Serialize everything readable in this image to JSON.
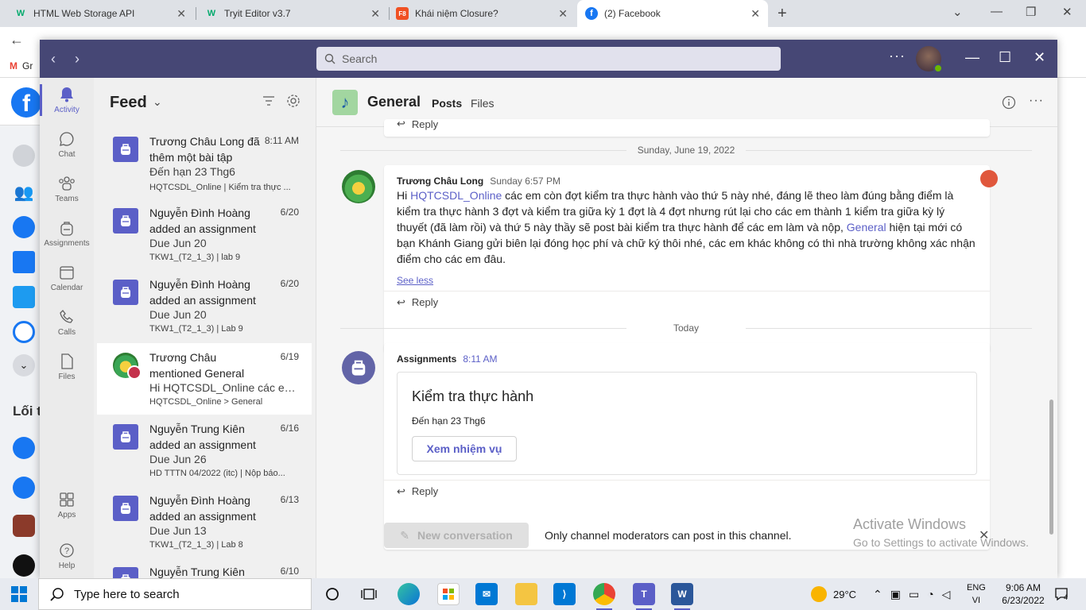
{
  "browser": {
    "tabs": [
      {
        "title": "HTML Web Storage API",
        "favicon": "W",
        "color": "#04aa6d"
      },
      {
        "title": "Tryit Editor v3.7",
        "favicon": "W",
        "color": "#04aa6d"
      },
      {
        "title": "Khái niệm Closure?",
        "favicon": "F8",
        "color": "#f05123"
      },
      {
        "title": "(2) Facebook",
        "favicon": "f",
        "color": "#1877f2"
      }
    ],
    "bookmark_label": "Gr",
    "fb_sidebar_text": "Lối t"
  },
  "teams": {
    "search_placeholder": "Search",
    "rail": [
      {
        "label": "Activity",
        "icon": "bell-icon"
      },
      {
        "label": "Chat",
        "icon": "chat-icon"
      },
      {
        "label": "Teams",
        "icon": "teams-icon"
      },
      {
        "label": "Assignments",
        "icon": "backpack-icon"
      },
      {
        "label": "Calendar",
        "icon": "calendar-icon"
      },
      {
        "label": "Calls",
        "icon": "phone-icon"
      },
      {
        "label": "Files",
        "icon": "file-icon"
      },
      {
        "label": "Apps",
        "icon": "apps-icon"
      },
      {
        "label": "Help",
        "icon": "help-icon"
      }
    ],
    "feed": {
      "title": "Feed",
      "items": [
        {
          "title": "Trương Châu Long đã thêm một bài tập",
          "date": "8:11 AM",
          "sub": "Đến hạn 23 Thg6",
          "meta": "HQTCSDL_Online | Kiểm tra thực ..."
        },
        {
          "title": "Nguyễn Đình Hoàng added an assignment",
          "date": "6/20",
          "sub": "Due Jun 20",
          "meta": "TKW1_(T2_1_3) | lab 9"
        },
        {
          "title": "Nguyễn Đình Hoàng added an assignment",
          "date": "6/20",
          "sub": "Due Jun 20",
          "meta": "TKW1_(T2_1_3) | Lab 9"
        },
        {
          "title": "Trương Châu mentioned General",
          "date": "6/19",
          "sub": "Hi HQTCSDL_Online các em ...",
          "meta": "HQTCSDL_Online > General"
        },
        {
          "title": "Nguyễn Trung Kiên added an assignment",
          "date": "6/16",
          "sub": "Due Jun 26",
          "meta": "HD TTTN 04/2022 (itc) | Nộp báo..."
        },
        {
          "title": "Nguyễn Đình Hoàng added an assignment",
          "date": "6/13",
          "sub": "Due Jun 13",
          "meta": "TKW1_(T2_1_3) | Lab 8"
        },
        {
          "title": "Nguyễn Trung Kiên",
          "date": "6/10",
          "sub": "",
          "meta": ""
        }
      ]
    },
    "channel": {
      "name": "General",
      "tabs": [
        "Posts",
        "Files"
      ],
      "reply_label": "Reply",
      "date1": "Sunday, June 19, 2022",
      "date2": "Today",
      "post": {
        "author": "Trương Châu Long",
        "time": "Sunday 6:57 PM",
        "mention1": "HQTCSDL_Online",
        "hi": "Hi",
        "text1": " các em còn đợt kiểm tra thực hành vào thứ 5 này nhé, đáng lẽ theo làm đúng bằng điểm là kiểm tra thực hành 3 đợt và kiểm tra giữa kỳ 1 đợt là 4 đợt nhưng rút lại cho các em thành 1 kiểm tra giữa kỳ lý thuyết (đã làm rồi) và thứ 5 này thầy sẽ post bài kiểm tra thực hành để các em làm và nộp, ",
        "mention2": "General",
        "text2": " hiện tại mới có bạn Khánh Giang gửi biên lại đóng học phí và chữ ký thôi nhé, các em khác không có thì nhà trường không xác nhận điểm cho các em đâu.",
        "see_less": "See less"
      },
      "assignment": {
        "author": "Assignments",
        "time": "8:11 AM",
        "title": "Kiểm tra thực hành",
        "due": "Đến hạn 23 Thg6",
        "button": "Xem nhiệm vụ"
      },
      "new_conversation": "New conversation",
      "moderator_note": "Only channel moderators can post in this channel.",
      "activate_title": "Activate Windows",
      "activate_sub": "Go to Settings to activate Windows."
    }
  },
  "taskbar": {
    "search_placeholder": "Type here to search",
    "weather": "29°C",
    "lang1": "ENG",
    "lang2": "VI",
    "time": "9:06 AM",
    "date": "6/23/2022",
    "notifications": "4"
  }
}
